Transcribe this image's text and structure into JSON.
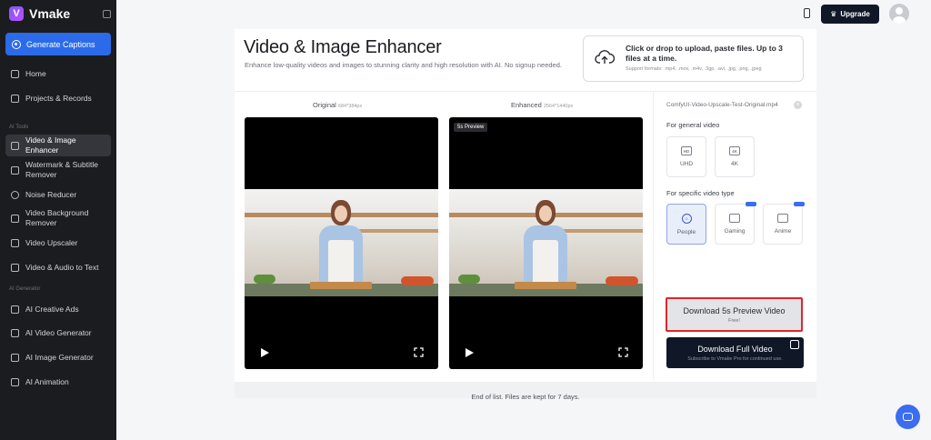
{
  "brand": {
    "name": "Vmake",
    "logo_letter": "V"
  },
  "sidebar": {
    "generate_label": "Generate Captions",
    "top_items": [
      {
        "label": "Home",
        "icon": "home-icon"
      },
      {
        "label": "Projects & Records",
        "icon": "projects-icon"
      }
    ],
    "section_tools": "AI Tools",
    "tool_items": [
      {
        "label": "Video & Image Enhancer",
        "icon": "enhancer-icon"
      },
      {
        "label": "Watermark & Subtitle Remover",
        "icon": "eraser-icon"
      },
      {
        "label": "Noise Reducer",
        "icon": "noise-icon"
      },
      {
        "label": "Video Background Remover",
        "icon": "background-icon"
      },
      {
        "label": "Video Upscaler",
        "icon": "upscaler-icon"
      },
      {
        "label": "Video & Audio to Text",
        "icon": "transcribe-icon"
      }
    ],
    "section_generator": "AI Generator",
    "generator_items": [
      {
        "label": "AI Creative Ads",
        "icon": "ads-icon"
      },
      {
        "label": "AI Video Generator",
        "icon": "video-generator-icon"
      },
      {
        "label": "AI Image Generator",
        "icon": "image-generator-icon"
      },
      {
        "label": "AI Animation",
        "icon": "animation-icon"
      }
    ]
  },
  "topbar": {
    "upgrade_label": "Upgrade"
  },
  "header": {
    "title": "Video & Image Enhancer",
    "subtitle": "Enhance low-quality videos and images to stunning clarity and high resolution with AI. No signup needed."
  },
  "upload": {
    "main": "Click or drop to upload, paste files. Up to 3 files at a time.",
    "formats": "Support formats: .mp4, .mov, .m4v, .3gp, .avi, .jpg, .png, .jpeg"
  },
  "videos": {
    "original_label": "Original",
    "original_dim": "684*384px",
    "enhanced_label": "Enhanced",
    "enhanced_dim": "2564*1440px",
    "preview_badge": "5s Preview"
  },
  "options": {
    "file_name": "ComfyUI-Video-Upscale-Test-Original.mp4",
    "general_heading": "For general video",
    "general": [
      {
        "label": "UHD",
        "icon": "HD"
      },
      {
        "label": "4K",
        "icon": "4K"
      }
    ],
    "specific_heading": "For specific video type",
    "specific": [
      {
        "label": "People",
        "icon": "people-icon",
        "selected": true
      },
      {
        "label": "Gaming",
        "icon": "gamepad-icon",
        "selected": false
      },
      {
        "label": "Anime",
        "icon": "anime-icon",
        "selected": false
      }
    ]
  },
  "download": {
    "preview_label": "Download 5s Preview Video",
    "preview_sub": "Free!",
    "full_label": "Download Full Video",
    "full_sub": "Subscribe to Vmake Pro for continued use."
  },
  "footer": {
    "text": "End of list. Files are kept for 7 days."
  },
  "colors": {
    "accent": "#2b6bea",
    "sidebar_bg": "#1b1c20",
    "highlight_border": "#e0262b",
    "dark_button": "#101828"
  }
}
